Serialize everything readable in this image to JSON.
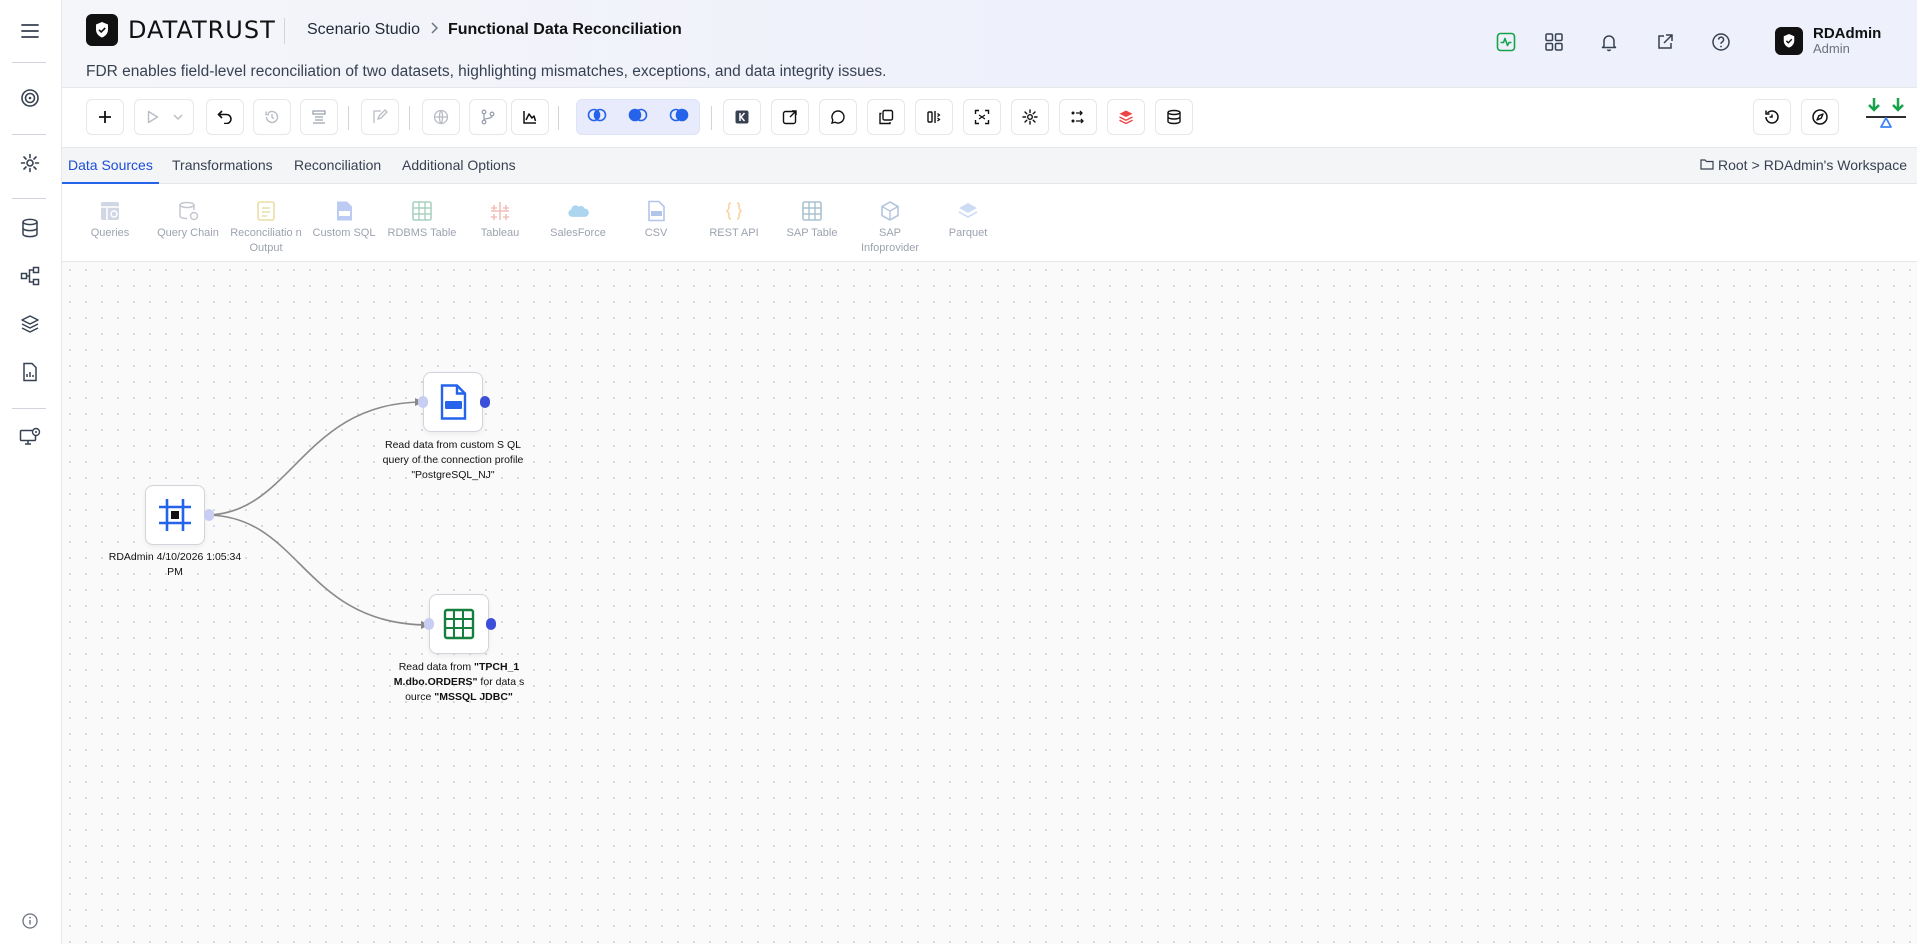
{
  "app": {
    "brand": "DATATRUST",
    "breadcrumb": {
      "parent": "Scenario Studio",
      "current": "Functional Data Reconciliation"
    },
    "subtitle": "FDR enables field-level reconciliation of two datasets, highlighting mismatches, exceptions, and data integrity issues."
  },
  "user": {
    "name": "RDAdmin",
    "role": "Admin"
  },
  "tabs": [
    {
      "label": "Data Sources",
      "active": true
    },
    {
      "label": "Transformations",
      "active": false
    },
    {
      "label": "Reconciliation",
      "active": false
    },
    {
      "label": "Additional Options",
      "active": false
    }
  ],
  "workspace_path": {
    "root": "Root",
    "separator": ">",
    "workspace": "RDAdmin's Workspace"
  },
  "palette": [
    {
      "label": "Queries",
      "icon": "queries-icon"
    },
    {
      "label": "Query Chain",
      "icon": "query-chain-icon"
    },
    {
      "label": "Reconciliatio n Output",
      "icon": "reconciliation-output-icon"
    },
    {
      "label": "Custom SQL",
      "icon": "custom-sql-icon"
    },
    {
      "label": "RDBMS Table",
      "icon": "rdbms-table-icon"
    },
    {
      "label": "Tableau",
      "icon": "tableau-icon"
    },
    {
      "label": "SalesForce",
      "icon": "salesforce-icon"
    },
    {
      "label": "CSV",
      "icon": "csv-icon"
    },
    {
      "label": "REST API",
      "icon": "rest-api-icon"
    },
    {
      "label": "SAP Table",
      "icon": "sap-table-icon"
    },
    {
      "label": "SAP Infoprovider",
      "icon": "sap-infoprovider-icon"
    },
    {
      "label": "Parquet",
      "icon": "parquet-icon"
    }
  ],
  "nodes": {
    "start": {
      "label": "RDAdmin 4/10/2026 1:05:34 PM"
    },
    "sql": {
      "label": "Read data from custom S QL query of the connection profile \"PostgreSQL_NJ\""
    },
    "table": {
      "pre": "Read data from ",
      "table": "\"TPCH_1 M.dbo.ORDERS\"",
      "mid": " for data s ource ",
      "source": "\"MSSQL JDBC\""
    }
  },
  "colors": {
    "accent": "#2563eb",
    "active_tab": "#1d4ed8",
    "status_green": "#16a34a",
    "edge": "#8a8a8a"
  }
}
